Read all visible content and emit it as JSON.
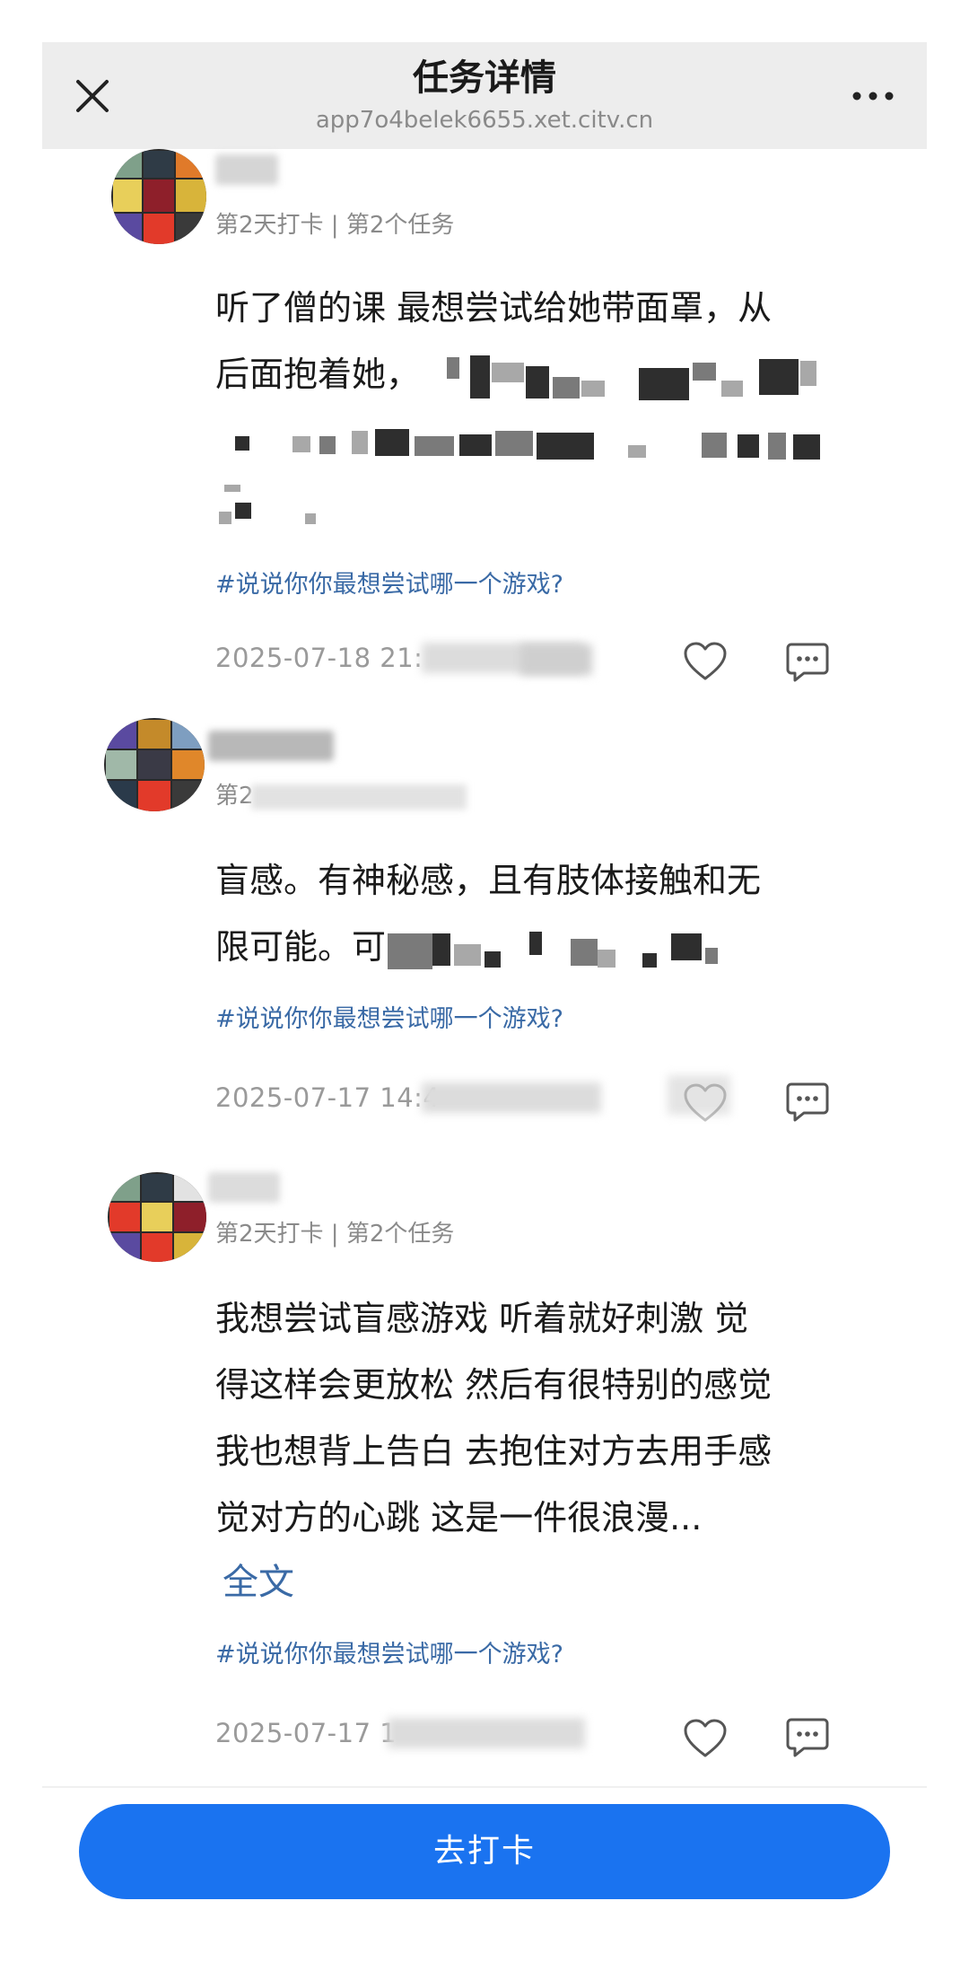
{
  "header": {
    "title": "任务详情",
    "url": "app7o4belek6655.xet.citv.cn",
    "close_icon": "close-icon",
    "more_icon": "more-icon"
  },
  "posts": [
    {
      "meta": "第2天打卡 | 第2个任务",
      "content_lines": [
        "听了僧的课 最想尝试给她带面罩，从",
        "后面抱着她，"
      ],
      "tag": "#说说你你最想尝试哪一个游戏?",
      "timestamp": "2025-07-18 21:"
    },
    {
      "meta": "第2",
      "content_lines": [
        "盲感。有神秘感，且有肢体接触和无",
        "限可能。可"
      ],
      "tag": "#说说你你最想尝试哪一个游戏?",
      "timestamp": "2025-07-17 14:4"
    },
    {
      "meta": "第2天打卡 | 第2个任务",
      "content_lines": [
        "我想尝试盲感游戏  听着就好刺激  觉",
        "得这样会更放松  然后有很特别的感觉",
        "我也想背上告白  去抱住对方去用手感",
        "觉对方的心跳  这是一件很浪漫..."
      ],
      "full_text_label": "全文",
      "tag": "#说说你你最想尝试哪一个游戏?",
      "timestamp": "2025-07-17 1"
    }
  ],
  "checkin_button": "去打卡",
  "colors": {
    "accent": "#1a73f0",
    "link": "#3a6aa6",
    "header_bg": "#ededed"
  }
}
